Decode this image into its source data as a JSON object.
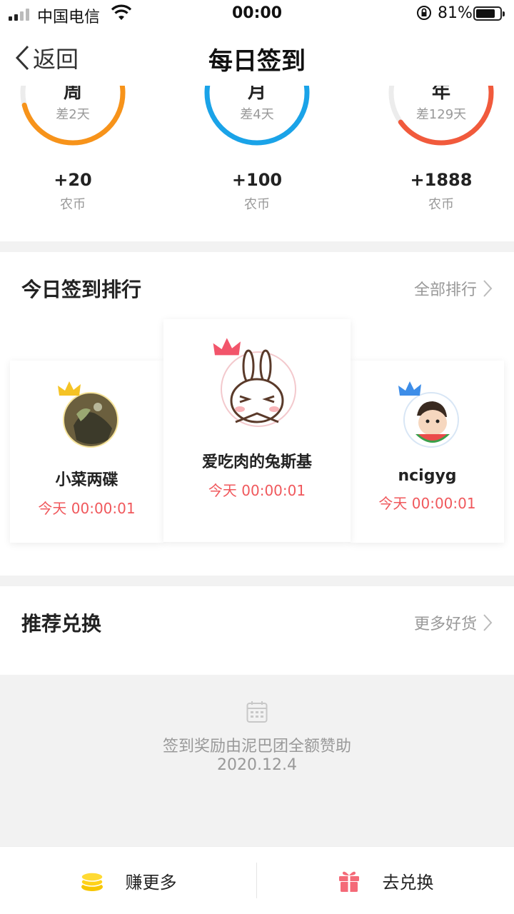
{
  "status_bar": {
    "carrier": "中国电信",
    "time": "00:00",
    "battery_percent": "81%",
    "battery_level": 0.81
  },
  "nav": {
    "back_label": "返回",
    "title": "每日签到"
  },
  "periods": [
    {
      "label": "周",
      "remaining": "差2天",
      "points": "+20",
      "unit": "农币",
      "color": "#f7931a",
      "progress": 0.71
    },
    {
      "label": "月",
      "remaining": "差4天",
      "points": "+100",
      "unit": "农币",
      "color": "#1aa3e8",
      "progress": 0.87
    },
    {
      "label": "年",
      "remaining": "差129天",
      "points": "+1888",
      "unit": "农币",
      "color": "#f15a3c",
      "progress": 0.65
    }
  ],
  "ranking": {
    "title": "今日签到排行",
    "more": "全部排行",
    "entries": [
      {
        "rank": 1,
        "name": "爱吃肉的兔斯基",
        "time": "今天 00:00:01",
        "crown_color": "#f2556b"
      },
      {
        "rank": 2,
        "name": "小菜两碟",
        "time": "今天 00:00:01",
        "crown_color": "#f5c325"
      },
      {
        "rank": 3,
        "name": "ncigyg",
        "time": "今天 00:00:01",
        "crown_color": "#3d8de8"
      }
    ]
  },
  "exchange": {
    "title": "推荐兑换",
    "more": "更多好货"
  },
  "footer_info": {
    "sponsor": "签到奖励由泥巴团全额赞助",
    "date": "2020.12.4"
  },
  "bottom_bar": {
    "earn_label": "赚更多",
    "exchange_label": "去兑换"
  }
}
